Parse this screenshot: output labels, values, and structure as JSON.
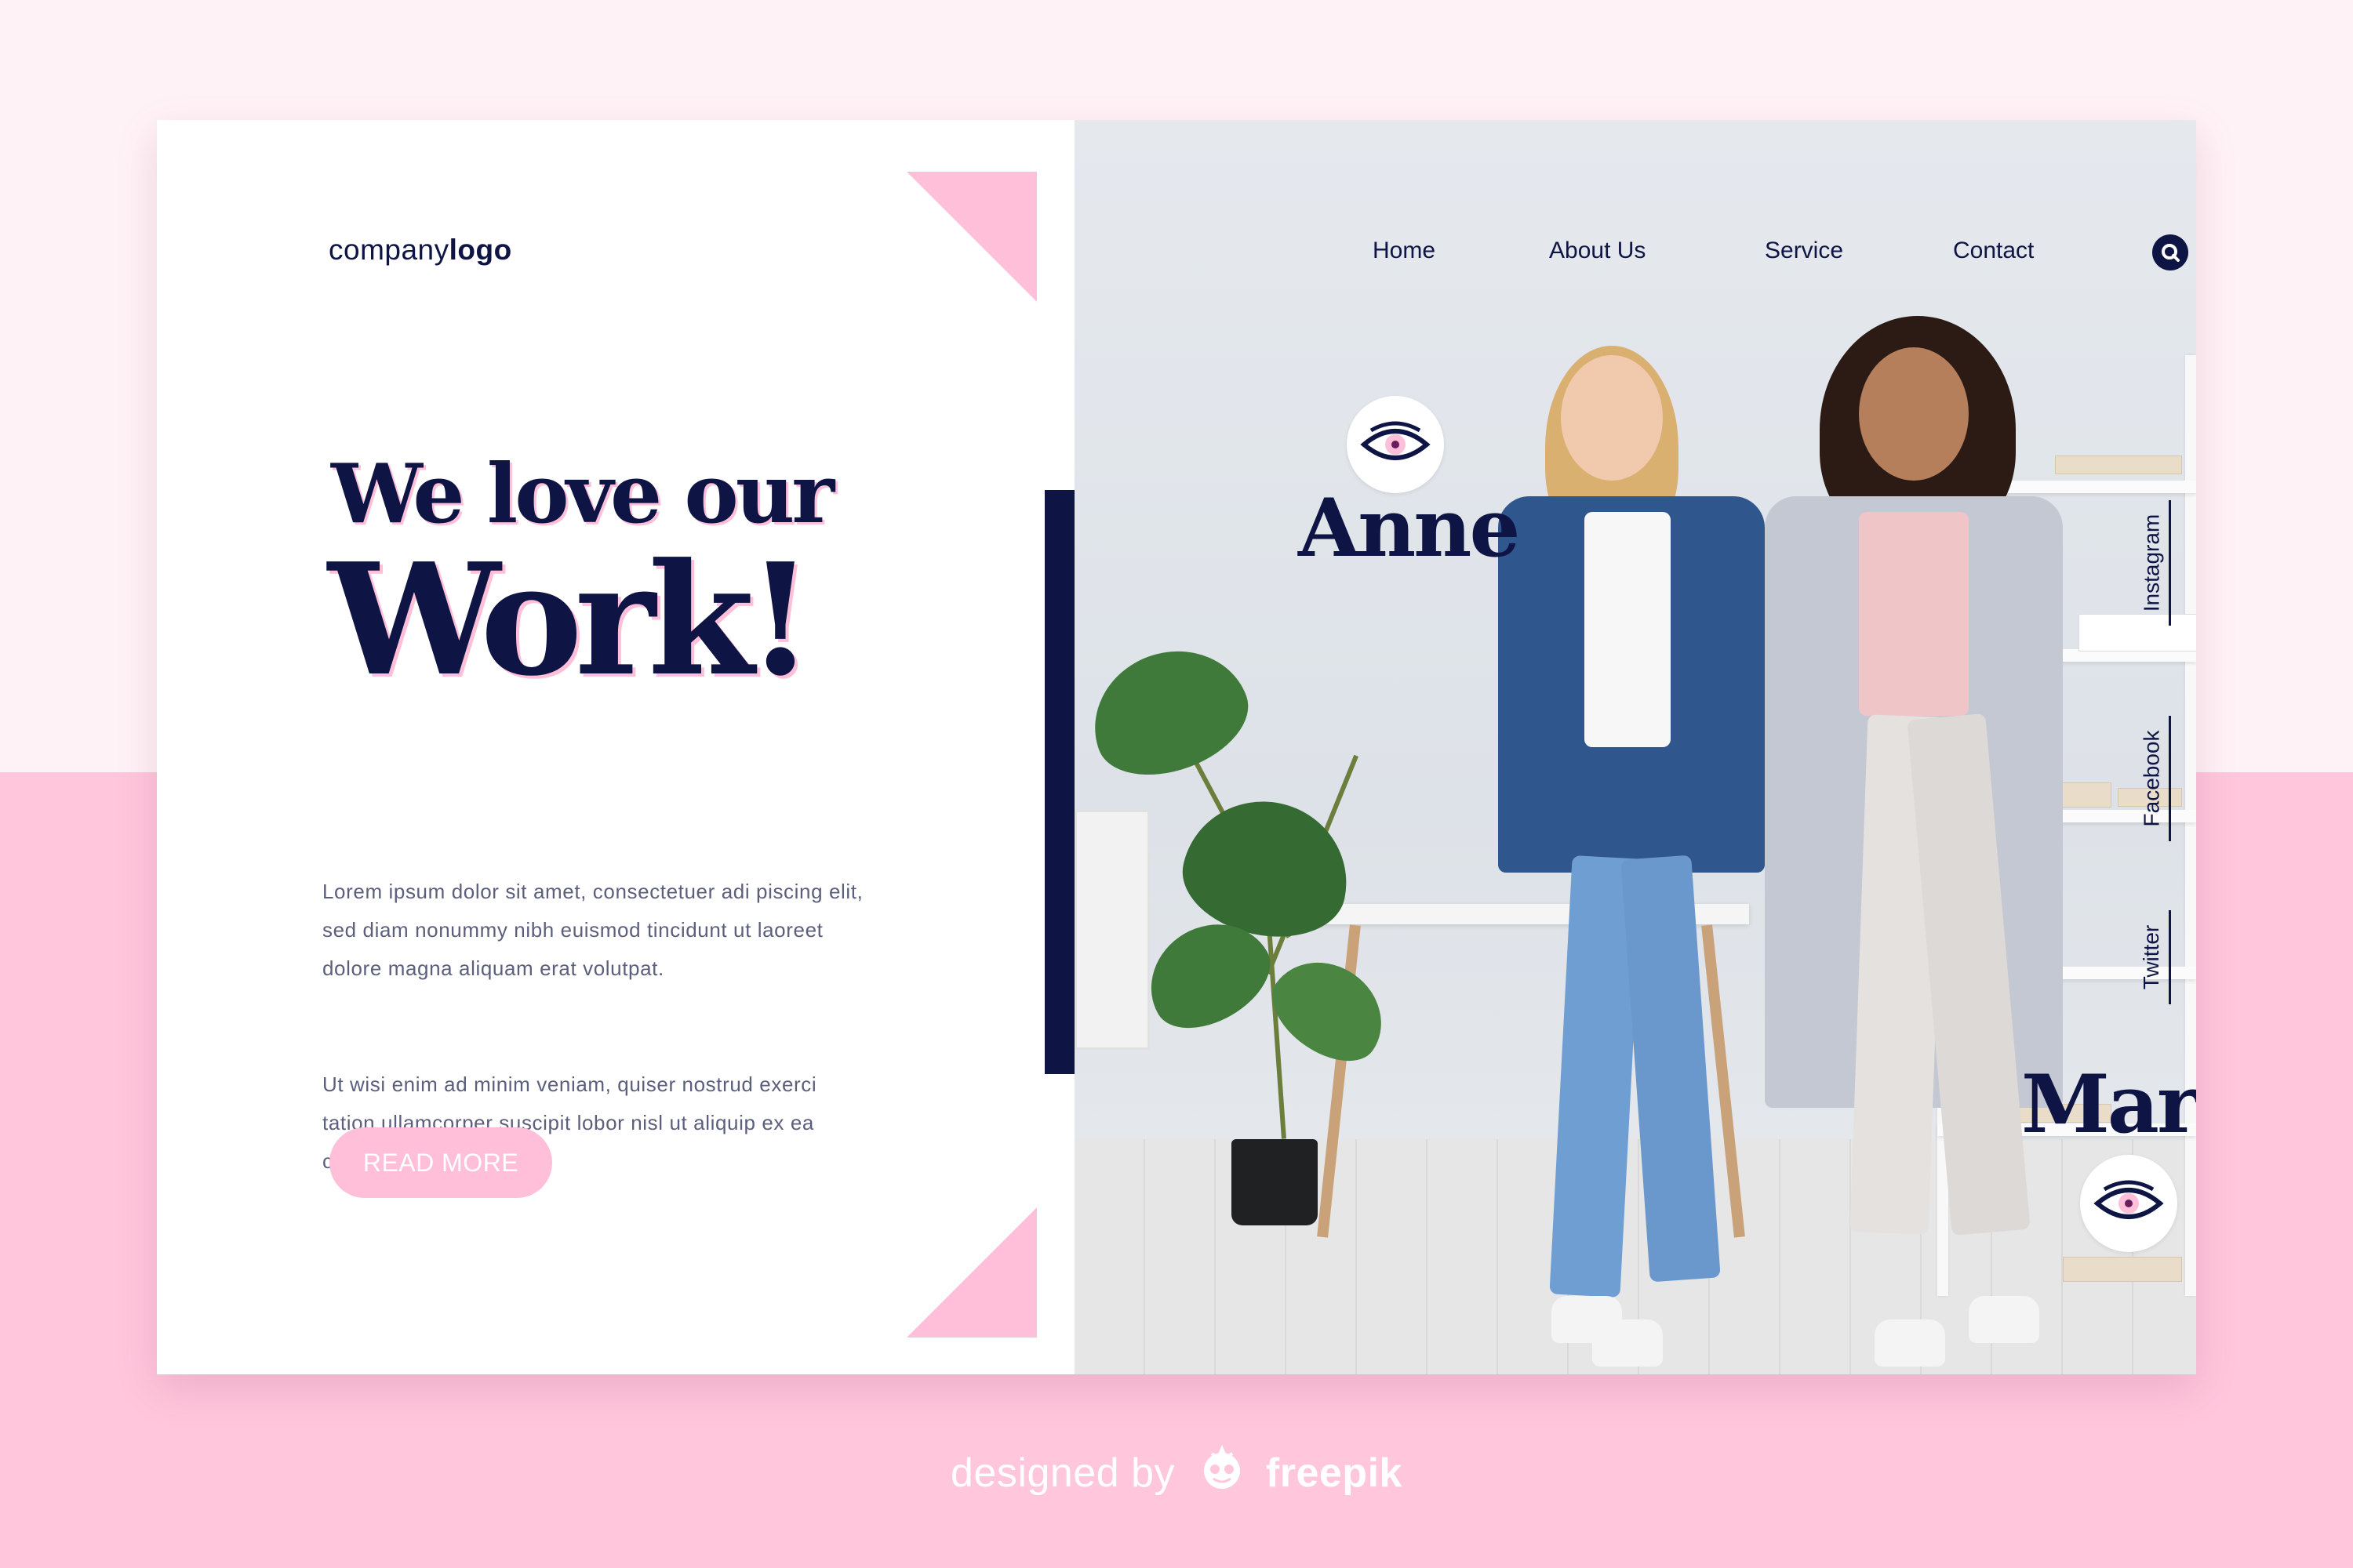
{
  "brand": {
    "logo_regular": "company",
    "logo_bold": "logo"
  },
  "hero": {
    "heading_line1": "We love our",
    "heading_line2": "Work!",
    "paragraph1": "Lorem ipsum dolor sit amet, consectetuer adi piscing elit, sed diam nonummy nibh euismod tincidunt ut laoreet dolore magna aliquam erat volutpat.",
    "paragraph2": "Ut wisi enim ad minim veniam, quiser nostrud exerci tation ullamcorper suscipit lobor nisl ut aliquip ex ea commodo consequat.",
    "button_label": "READ MORE"
  },
  "nav": {
    "items": [
      {
        "label": "Home"
      },
      {
        "label": "About Us"
      },
      {
        "label": "Service"
      },
      {
        "label": "Contact"
      }
    ],
    "search_icon": "search-icon"
  },
  "team": [
    {
      "name": "Anne",
      "icon": "eye-icon"
    },
    {
      "name": "Marie",
      "icon": "eye-icon"
    }
  ],
  "social": [
    {
      "label": "Instagram"
    },
    {
      "label": "Facebook"
    },
    {
      "label": "Twitter"
    }
  ],
  "footer": {
    "prefix": "designed by",
    "brand": "freepik",
    "mascot_icon": "freepik-mascot-icon"
  },
  "colors": {
    "navy": "#0e1444",
    "pink": "#ffbfd8",
    "background_light": "#fff2f6",
    "background_pink": "#ffc6dc",
    "text_gray": "#5b5f7c"
  }
}
